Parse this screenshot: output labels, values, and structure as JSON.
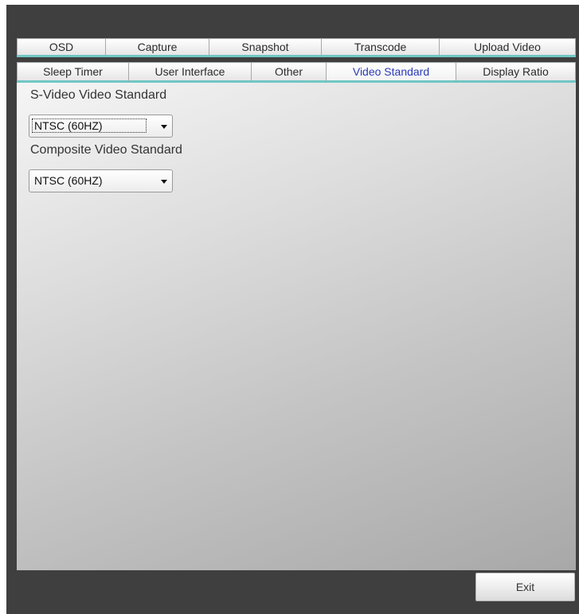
{
  "tabs_row1": [
    "OSD",
    "Capture",
    "Snapshot",
    "Transcode",
    "Upload Video"
  ],
  "tabs_row2": [
    "Sleep Timer",
    "User Interface",
    "Other",
    "Video Standard",
    "Display Ratio"
  ],
  "active_tab": "Video Standard",
  "svideo": {
    "label": "S-Video Video Standard",
    "value": "NTSC (60HZ)"
  },
  "composite": {
    "label": "Composite Video Standard",
    "value": "NTSC (60HZ)"
  },
  "exit_label": "Exit",
  "colors": {
    "frame_bg": "#3f3f3f",
    "tab_accent": "#6fc7c4",
    "active_tab_text": "#2a3ab8"
  }
}
